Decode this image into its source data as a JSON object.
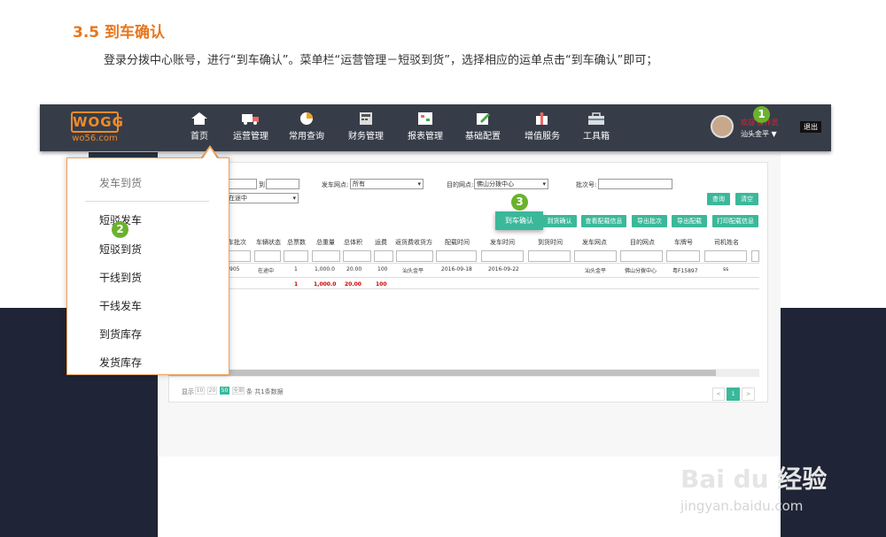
{
  "doc": {
    "heading": "3.5 到车确认",
    "intro": "登录分拨中心账号，进行“到车确认”。菜单栏“运营管理－短驳到货”，选择相应的运单点击“到车确认”即可；"
  },
  "logo": {
    "mark": "WOGG",
    "url": "wo56.com"
  },
  "nav": [
    "首页",
    "运营管理",
    "常用查询",
    "财务管理",
    "报表管理",
    "基础配置",
    "增值服务",
    "工具箱"
  ],
  "user": {
    "welcome": "欢迎 操作员",
    "name": "汕头金平",
    "logout": "退出"
  },
  "badges": [
    "1",
    "2",
    "3"
  ],
  "filters": {
    "to": "到",
    "dispatch_point_label": "发车网点:",
    "dispatch_point_value": "所有",
    "dest_point_label": "目的网点:",
    "dest_point_value": "佛山分拨中心",
    "batch_label": "批次号:",
    "status_value": "在途中",
    "query": "查询",
    "clear": "清空"
  },
  "actions": {
    "confirm": "到车确认",
    "goods_confirm": "到货确认",
    "view_load": "查看配载信息",
    "export_batch": "导出批次",
    "export_load": "导出配载",
    "print_load": "打印配载信息"
  },
  "table": {
    "headers": [
      "车批次",
      "车辆状态",
      "总票数",
      "总重量",
      "总体积",
      "运费",
      "返货费收货方",
      "配载时间",
      "发车时间",
      "到货时间",
      "发车网点",
      "目的网点",
      "车牌号",
      "司机姓名"
    ],
    "row": [
      "905",
      "在途中",
      "1",
      "1,000.0",
      "20.00",
      "100",
      "汕头金平",
      "2016-09-18",
      "2016-09-22",
      "",
      "汕头金平",
      "佛山分拨中心",
      "粤F15897",
      "ss"
    ],
    "totals": [
      "1",
      "1,000.0",
      "20.00",
      "100"
    ]
  },
  "pager": {
    "show": "显示",
    "sizes": [
      "10",
      "20",
      "50",
      "全部"
    ],
    "summary": "条 共1条数据",
    "prev": "<",
    "page": "1",
    "next": ">"
  },
  "popup": {
    "title": "发车到货",
    "items": [
      "短驳发车",
      "短驳到货",
      "干线到货",
      "干线发车",
      "到货库存",
      "发货库存"
    ]
  },
  "watermark": {
    "brand": "Bai du 经验",
    "url": "jingyan.baidu.com"
  },
  "colors": {
    "accent": "#3bb89a",
    "orange": "#e8761c",
    "badge": "#6ab22d",
    "nav_bg": "#373d48"
  }
}
